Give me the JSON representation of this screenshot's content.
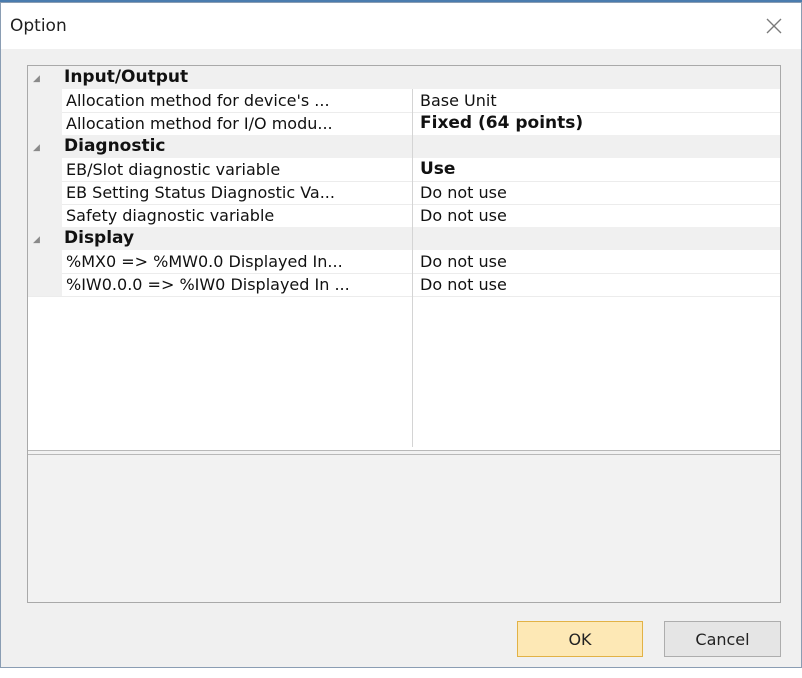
{
  "dialog": {
    "title": "Option",
    "close_icon": "close-icon"
  },
  "property_grid": {
    "categories": [
      {
        "name": "Input/Output",
        "expanded": true,
        "properties": [
          {
            "name": "Allocation method for device's ...",
            "value": "Base Unit",
            "bold": false
          },
          {
            "name": "Allocation method for I/O modu...",
            "value": "Fixed (64 points)",
            "bold": true
          }
        ]
      },
      {
        "name": "Diagnostic",
        "expanded": true,
        "properties": [
          {
            "name": "EB/Slot diagnostic variable",
            "value": "Use",
            "bold": true
          },
          {
            "name": "EB Setting Status Diagnostic Va...",
            "value": "Do not use",
            "bold": false
          },
          {
            "name": "Safety diagnostic variable",
            "value": "Do not use",
            "bold": false
          }
        ]
      },
      {
        "name": "Display",
        "expanded": true,
        "properties": [
          {
            "name": "%MX0 => %MW0.0 Displayed In...",
            "value": "Do not use",
            "bold": false
          },
          {
            "name": "%IW0.0.0 => %IW0 Displayed In ...",
            "value": "Do not use",
            "bold": false
          }
        ]
      }
    ],
    "description": ""
  },
  "buttons": {
    "ok_label": "OK",
    "cancel_label": "Cancel"
  },
  "colors": {
    "ok_button_bg": "#fde8b5",
    "ok_button_border": "#e2b246",
    "category_bg": "#f0f0f0",
    "window_border": "#4a7cae"
  }
}
